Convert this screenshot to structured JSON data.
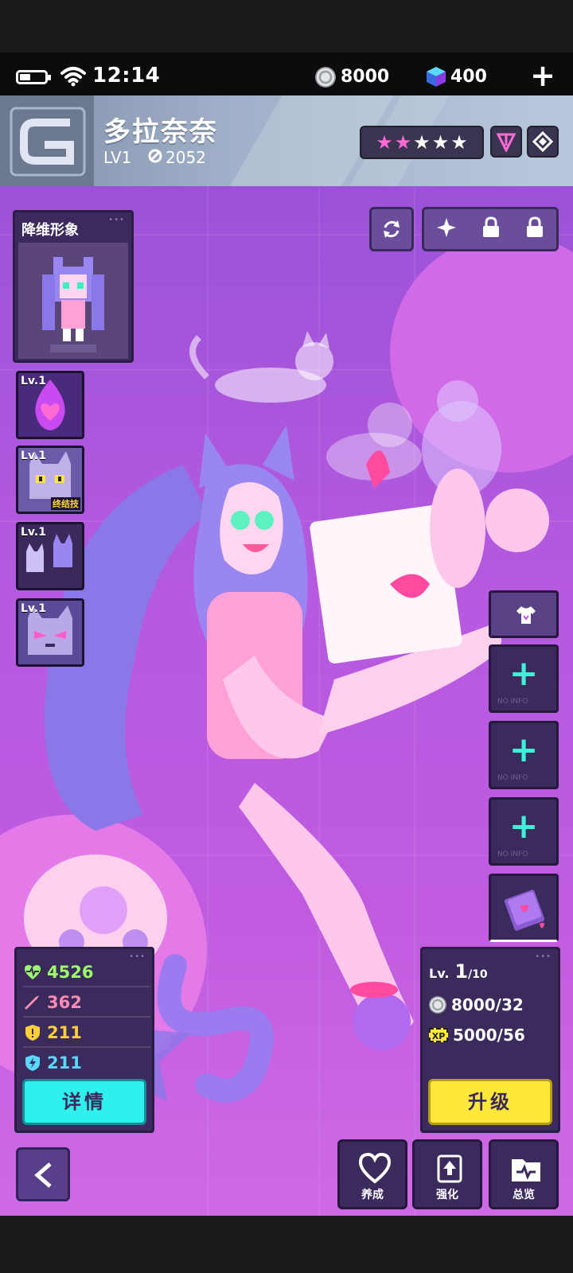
{
  "status": {
    "time": "12:14",
    "battery_percent": 40,
    "coins": "8000",
    "gems": "400"
  },
  "character": {
    "name": "多拉奈奈",
    "level": "LV1",
    "power": "2052",
    "star_rating": {
      "filled_pink": 2,
      "white": 3
    }
  },
  "avatar_panel": {
    "title": "降维形象"
  },
  "skills": [
    {
      "level": "Lv.1",
      "icon": "flame-heart-icon",
      "tag": ""
    },
    {
      "level": "Lv.1",
      "icon": "tabby-cat-face-icon",
      "tag": "终结技"
    },
    {
      "level": "Lv.1",
      "icon": "cat-silhouettes-icon",
      "tag": ""
    },
    {
      "level": "Lv.1",
      "icon": "angry-cat-face-icon",
      "tag": ""
    }
  ],
  "equipment_slots": {
    "empty_label": "NO INFO",
    "count": 3
  },
  "stats": {
    "hp": "4526",
    "attack": "362",
    "defense": "211",
    "speed": "211",
    "detail_button": "详情"
  },
  "upgrade": {
    "level_prefix": "Lv.",
    "level": "1",
    "level_max": "/10",
    "coin_cost": "8000/32",
    "xp_cost": "5000/56",
    "xp_label": "XP",
    "upgrade_button": "升级"
  },
  "nav": {
    "nurture": "养成",
    "enhance": "强化",
    "overview": "总览"
  },
  "colors": {
    "hp": "#9cff6a",
    "attack": "#ff8ab4",
    "defense": "#ffcf3a",
    "speed": "#5ad8ff",
    "accent_cyan": "#2ef0ec",
    "accent_yellow": "#ffe83a",
    "stage_purple": "#b65ae0"
  }
}
